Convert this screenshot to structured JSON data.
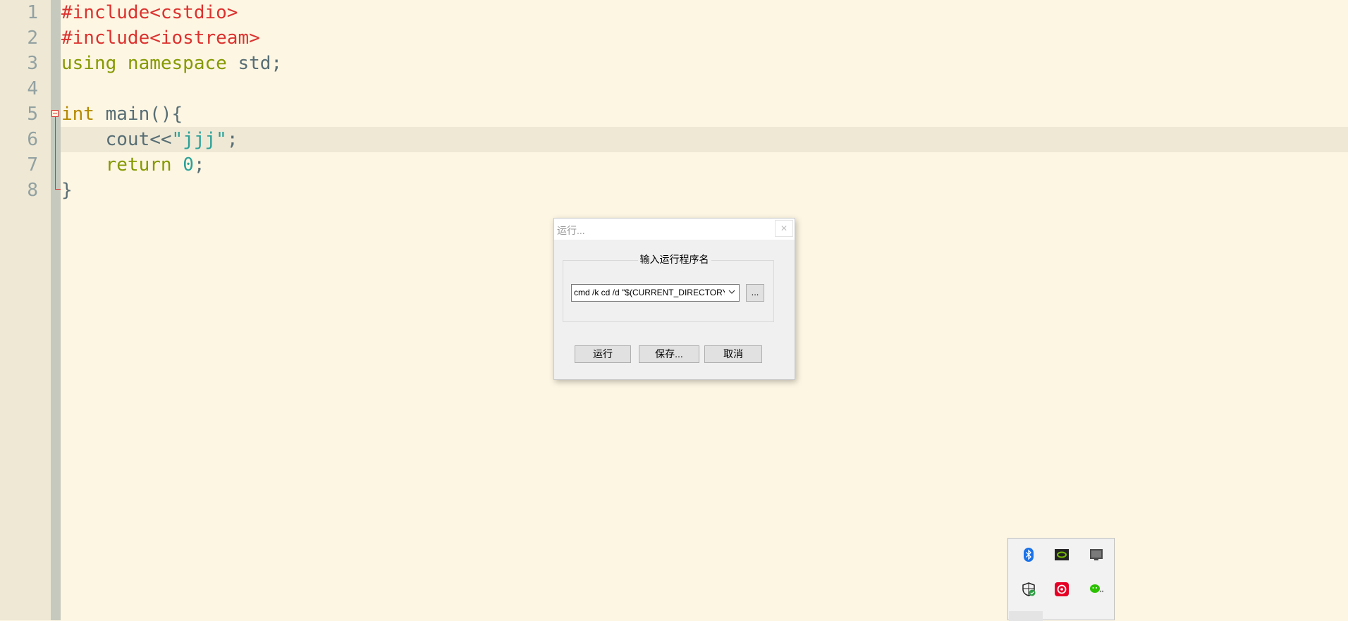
{
  "editor": {
    "line_numbers": [
      "1",
      "2",
      "3",
      "4",
      "5",
      "6",
      "7",
      "8"
    ],
    "lines": [
      [
        {
          "text": "#include<cstdio>",
          "kind": "pre"
        }
      ],
      [
        {
          "text": "#include<iostream>",
          "kind": "pre"
        }
      ],
      [
        {
          "text": "using namespace",
          "kind": "kw"
        },
        {
          "text": " std;",
          "kind": "plain"
        }
      ],
      [],
      [
        {
          "text": "int",
          "kind": "type"
        },
        {
          "text": " main(){",
          "kind": "plain"
        }
      ],
      [
        {
          "text": "    cout<<",
          "kind": "plain"
        },
        {
          "text": "\"jjj\"",
          "kind": "str"
        },
        {
          "text": ";",
          "kind": "plain"
        }
      ],
      [
        {
          "text": "    return",
          "kind": "kw"
        },
        {
          "text": " ",
          "kind": "plain"
        },
        {
          "text": "0",
          "kind": "num"
        },
        {
          "text": ";",
          "kind": "plain"
        }
      ],
      [
        {
          "text": "}",
          "kind": "plain"
        }
      ]
    ],
    "current_line": 6
  },
  "dialog": {
    "title": "运行...",
    "close_label": "✕",
    "group_label": "输入运行程序名",
    "command_value": "cmd /k cd /d \"$(CURRENT_DIRECTORY)\"",
    "browse_label": "...",
    "run_label": "运行",
    "save_label": "保存...",
    "cancel_label": "取消"
  },
  "tray": {
    "icons": [
      "bluetooth-icon",
      "nvidia-icon",
      "display-icon",
      "security-shield-icon",
      "netease-music-icon",
      "wechat-icon"
    ]
  },
  "colors": {
    "background": "#fdf6e3",
    "preprocessor": "#dc322f",
    "keyword": "#859900",
    "type": "#b58900",
    "string": "#2aa198"
  }
}
